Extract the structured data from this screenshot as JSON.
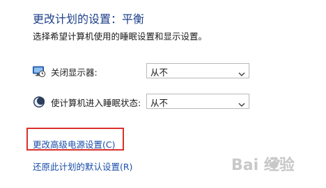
{
  "header": {
    "title": "更改计划的设置：平衡",
    "subtitle": "选择希望计算机使用的睡眠设置和显示设置。"
  },
  "settings": [
    {
      "label": "关闭显示器:",
      "icon": "monitor-clock-icon",
      "value": "从不"
    },
    {
      "label": "使计算机进入睡眠状态:",
      "icon": "sleep-moon-icon",
      "value": "从不"
    }
  ],
  "links": {
    "advanced": "更改高级电源设置(C)",
    "restore": "还原此计划的默认设置(R)"
  },
  "highlight": {
    "color": "#d9302c"
  },
  "watermark": {
    "text": "Bai  经验",
    "icon": "baidu-paw-icon"
  }
}
